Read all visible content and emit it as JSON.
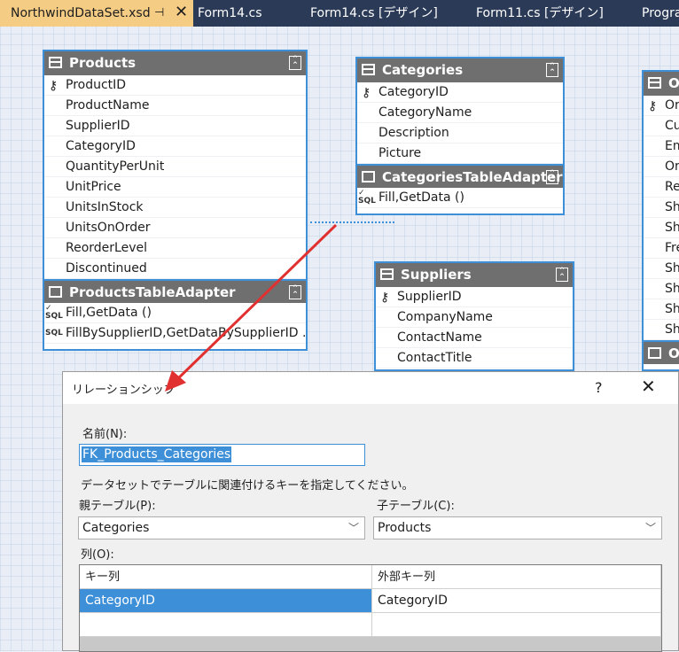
{
  "tabs": [
    {
      "label": "NorthwindDataSet.xsd",
      "active": true
    },
    {
      "label": "Form14.cs"
    },
    {
      "label": "Form14.cs [デザイン]"
    },
    {
      "label": "Form11.cs [デザイン]"
    },
    {
      "label": "Progra"
    }
  ],
  "products": {
    "title": "Products",
    "columns": [
      "ProductID",
      "ProductName",
      "SupplierID",
      "CategoryID",
      "QuantityPerUnit",
      "UnitPrice",
      "UnitsInStock",
      "UnitsOnOrder",
      "ReorderLevel",
      "Discontinued"
    ],
    "adapter_title": "ProductsTableAdapter",
    "methods": [
      "Fill,GetData ()",
      "FillBySupplierID,GetDataBySupplierID ..."
    ]
  },
  "categories": {
    "title": "Categories",
    "columns": [
      "CategoryID",
      "CategoryName",
      "Description",
      "Picture"
    ],
    "adapter_title": "CategoriesTableAdapter",
    "methods": [
      "Fill,GetData ()"
    ]
  },
  "suppliers": {
    "title": "Suppliers",
    "columns": [
      "SupplierID",
      "CompanyName",
      "ContactName",
      "ContactTitle"
    ]
  },
  "orders": {
    "title": "O",
    "columns": [
      "Or",
      "Cu",
      "Em",
      "Or",
      "Re",
      "Sh",
      "Sh",
      "Fre",
      "Sh",
      "Sh",
      "Sh",
      "Sh"
    ],
    "adapter_title": "O"
  },
  "icons": {
    "sql": "SQL",
    "key": "key-icon",
    "pin": "pin-icon",
    "close": "close-icon"
  },
  "dialog": {
    "title": "リレーションシップ",
    "help": "?",
    "close": "✕",
    "name_label": "名前(N):",
    "name_value": "FK_Products_Categories",
    "instruction": "データセットでテーブルに関連付けるキーを指定してください。",
    "parent_label": "親テーブル(P):",
    "parent_value": "Categories",
    "child_label": "子テーブル(C):",
    "child_value": "Products",
    "columns_label": "列(O):",
    "grid_headers": [
      "キー列",
      "外部キー列"
    ],
    "grid_rows": [
      {
        "key": "CategoryID",
        "foreign": "CategoryID"
      },
      {
        "key": "",
        "foreign": ""
      }
    ]
  },
  "colors": {
    "accent": "#3d8fd8",
    "tab_active": "#f5cc84",
    "arrow": "#e03030"
  }
}
